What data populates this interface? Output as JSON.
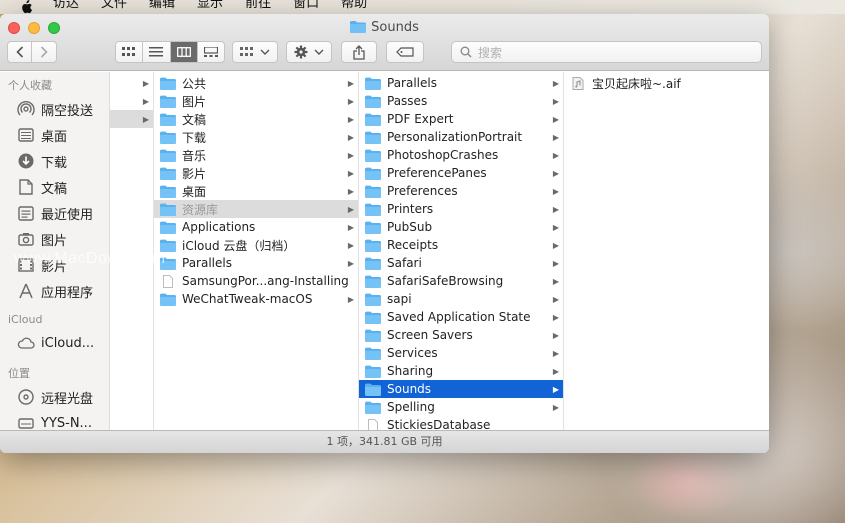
{
  "menubar": {
    "items": [
      "访达",
      "文件",
      "编辑",
      "显示",
      "前往",
      "窗口",
      "帮助"
    ]
  },
  "window": {
    "title": "Sounds"
  },
  "toolbar": {
    "search_placeholder": "搜索"
  },
  "sidebar": {
    "favorites_header": "个人收藏",
    "favorites": [
      {
        "label": "隔空投送",
        "icon": "airdrop-icon"
      },
      {
        "label": "桌面",
        "icon": "desktop-icon"
      },
      {
        "label": "下载",
        "icon": "downloads-icon"
      },
      {
        "label": "文稿",
        "icon": "documents-icon"
      },
      {
        "label": "最近使用",
        "icon": "recents-icon"
      },
      {
        "label": "图片",
        "icon": "pictures-icon"
      },
      {
        "label": "影片",
        "icon": "movies-icon"
      },
      {
        "label": "应用程序",
        "icon": "applications-icon"
      }
    ],
    "icloud_header": "iCloud",
    "icloud": [
      {
        "label": "iCloud...",
        "icon": "cloud-icon"
      }
    ],
    "locations_header": "位置",
    "locations": [
      {
        "label": "远程光盘",
        "icon": "disc-icon"
      },
      {
        "label": "YYS-N...",
        "icon": "drive-icon"
      }
    ]
  },
  "columns": {
    "col1": [
      {
        "name": "公共",
        "type": "folder"
      },
      {
        "name": "图片",
        "type": "folder"
      },
      {
        "name": "文稿",
        "type": "folder"
      },
      {
        "name": "下载",
        "type": "folder"
      },
      {
        "name": "音乐",
        "type": "folder"
      },
      {
        "name": "影片",
        "type": "folder"
      },
      {
        "name": "桌面",
        "type": "folder"
      },
      {
        "name": "资源库",
        "type": "folder",
        "state": "dim"
      },
      {
        "name": "Applications",
        "type": "folder"
      },
      {
        "name": "iCloud 云盘（归档）",
        "type": "folder"
      },
      {
        "name": "Parallels",
        "type": "folder"
      },
      {
        "name": "SamsungPor...ang-Installing",
        "type": "file"
      },
      {
        "name": "WeChatTweak-macOS",
        "type": "folder"
      }
    ],
    "col2": [
      {
        "name": "Parallels",
        "type": "folder"
      },
      {
        "name": "Passes",
        "type": "folder"
      },
      {
        "name": "PDF Expert",
        "type": "folder"
      },
      {
        "name": "PersonalizationPortrait",
        "type": "folder"
      },
      {
        "name": "PhotoshopCrashes",
        "type": "folder"
      },
      {
        "name": "PreferencePanes",
        "type": "folder"
      },
      {
        "name": "Preferences",
        "type": "folder"
      },
      {
        "name": "Printers",
        "type": "folder"
      },
      {
        "name": "PubSub",
        "type": "folder"
      },
      {
        "name": "Receipts",
        "type": "folder"
      },
      {
        "name": "Safari",
        "type": "folder"
      },
      {
        "name": "SafariSafeBrowsing",
        "type": "folder"
      },
      {
        "name": "sapi",
        "type": "folder"
      },
      {
        "name": "Saved Application State",
        "type": "folder"
      },
      {
        "name": "Screen Savers",
        "type": "folder"
      },
      {
        "name": "Services",
        "type": "folder"
      },
      {
        "name": "Sharing",
        "type": "folder"
      },
      {
        "name": "Sounds",
        "type": "folder",
        "state": "sel"
      },
      {
        "name": "Spelling",
        "type": "folder"
      },
      {
        "name": "StickiesDatabase",
        "type": "file"
      }
    ],
    "col3": [
      {
        "name": "宝贝起床啦~.aif",
        "type": "audio"
      }
    ]
  },
  "status": {
    "text": "1 项，341.81 GB 可用"
  },
  "watermark": "www.MacDown.com",
  "colors": {
    "selection": "#1163d6",
    "folder": "#5ab1ef"
  }
}
